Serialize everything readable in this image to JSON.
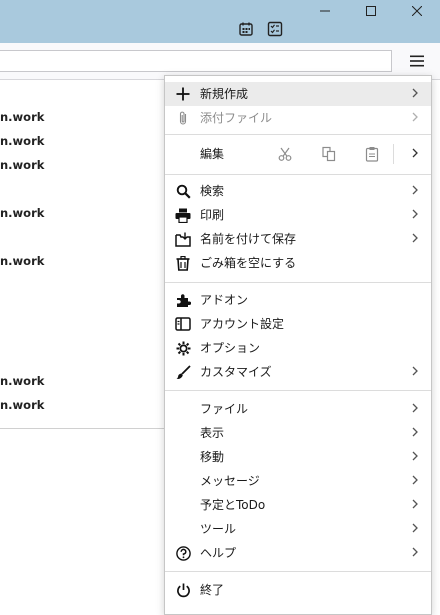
{
  "window": {
    "minimize_icon": "minimize-icon",
    "maximize_icon": "maximize-icon",
    "close_icon": "close-icon",
    "titlebar_color": "#a9c9dd"
  },
  "toolbar": {
    "calendar_icon": "calendar-icon",
    "tasks_icon": "tasks-icon",
    "menu_icon": "hamburger-menu-icon"
  },
  "message_list": {
    "items": [
      "n.work",
      "n.work",
      "n.work",
      "n.work",
      "n.work",
      "n.work",
      "n.work"
    ]
  },
  "menu": {
    "new": "新規作成",
    "attach": "添付ファイル",
    "edit": "編集",
    "search": "検索",
    "print": "印刷",
    "save_as": "名前を付けて保存",
    "empty_trash": "ごみ箱を空にする",
    "addons": "アドオン",
    "account_settings": "アカウント設定",
    "options": "オプション",
    "customize": "カスタマイズ",
    "file": "ファイル",
    "view": "表示",
    "go": "移動",
    "message": "メッセージ",
    "events_tasks": "予定とToDo",
    "tools": "ツール",
    "help": "ヘルプ",
    "quit": "終了"
  }
}
